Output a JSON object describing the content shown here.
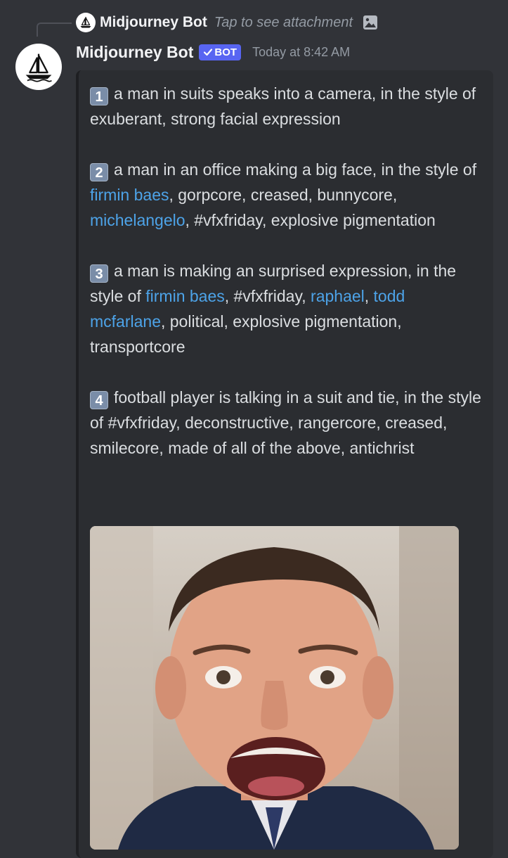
{
  "reply": {
    "username": "Midjourney Bot",
    "text": "Tap to see attachment",
    "attachment_icon": "image-icon"
  },
  "message": {
    "username": "Midjourney Bot",
    "bot_tag": "BOT",
    "verified_icon": "checkmark-icon",
    "timestamp": "Today at 8:42 AM",
    "avatar_icon": "sailboat-icon"
  },
  "colors": {
    "background": "#313338",
    "embed": "#2b2d31",
    "link": "#4da3e8",
    "bot_tag": "#5865f2"
  },
  "prompts": [
    {
      "number": "1",
      "parts": [
        {
          "text": "a man in suits speaks into a camera, in the style of exuberant, strong facial expression",
          "link": false
        }
      ]
    },
    {
      "number": "2",
      "parts": [
        {
          "text": "a man in an office making a big face, in the style of ",
          "link": false
        },
        {
          "text": "firmin baes",
          "link": true
        },
        {
          "text": ", gorpcore, creased, bunnycore, ",
          "link": false
        },
        {
          "text": "michelangelo",
          "link": true
        },
        {
          "text": ", #vfxfriday, explosive pigmentation",
          "link": false
        }
      ]
    },
    {
      "number": "3",
      "parts": [
        {
          "text": "a man is making an surprised expression, in the style of ",
          "link": false
        },
        {
          "text": "firmin baes",
          "link": true
        },
        {
          "text": ", #vfxfriday, ",
          "link": false
        },
        {
          "text": "raphael",
          "link": true
        },
        {
          "text": ", ",
          "link": false
        },
        {
          "text": "todd mcfarlane",
          "link": true
        },
        {
          "text": ", political, explosive pigmentation, transportcore",
          "link": false
        }
      ]
    },
    {
      "number": "4",
      "parts": [
        {
          "text": "football player is talking in a suit and tie, in the style of #vfxfriday, deconstructive, rangercore, creased, smilecore, made of all of the above, antichrist",
          "link": false
        }
      ]
    }
  ],
  "image": {
    "subject": "portrait of a man with a wide-open surprised expression"
  }
}
